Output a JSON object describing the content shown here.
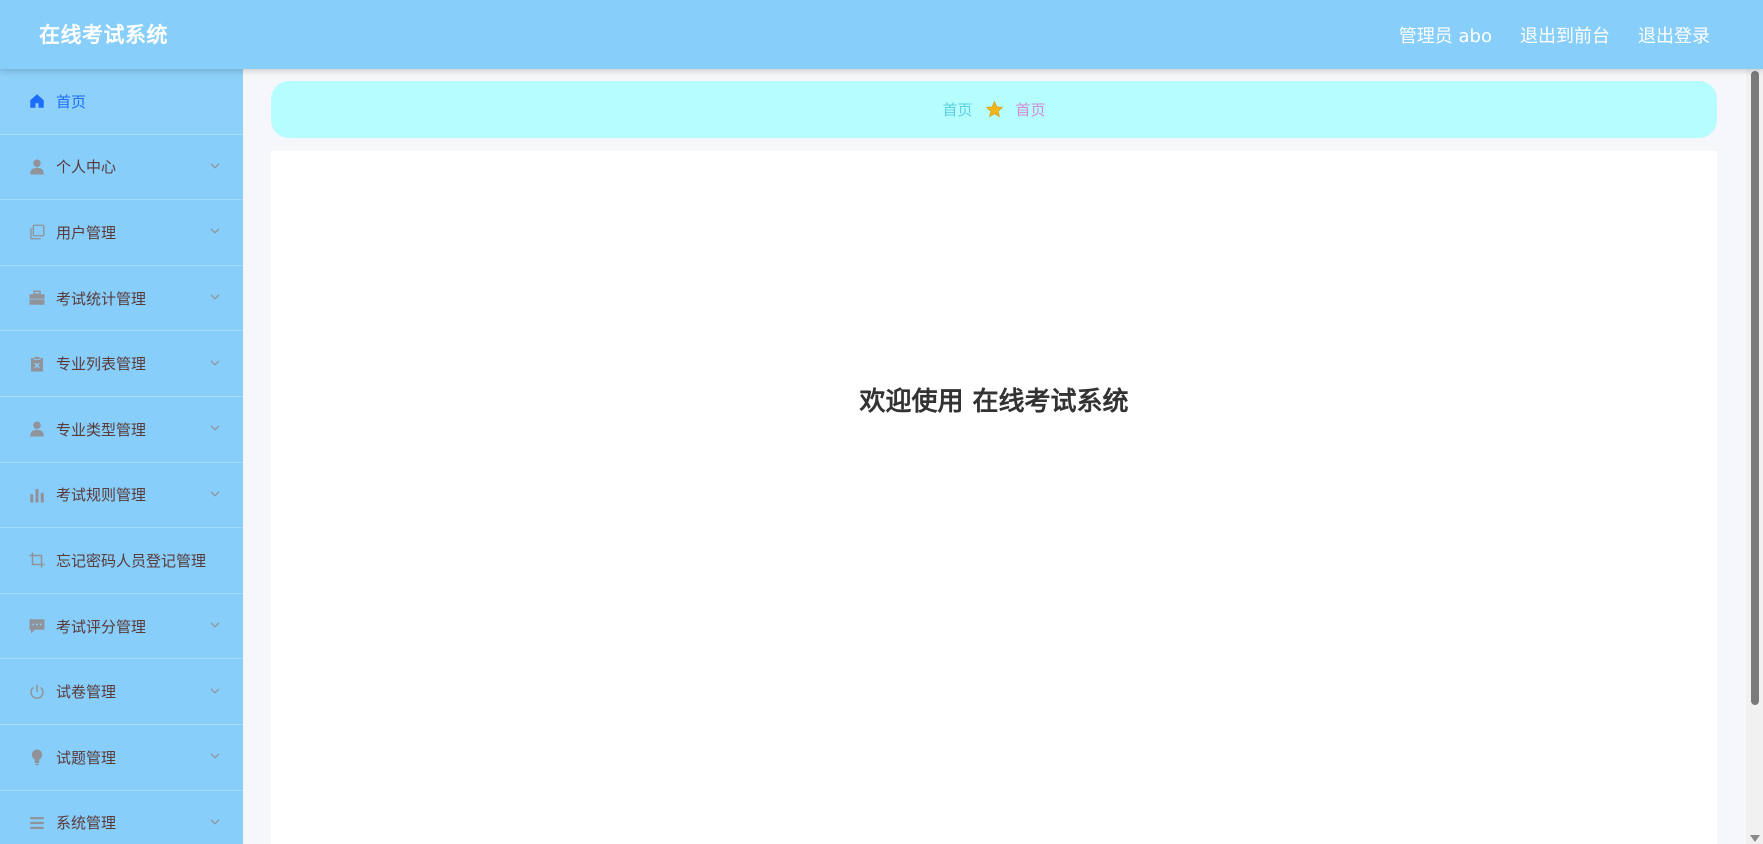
{
  "app": {
    "title": "在线考试系统"
  },
  "header": {
    "user_label": "管理员 abo",
    "to_front_label": "退出到前台",
    "logout_label": "退出登录"
  },
  "sidebar": {
    "items": [
      {
        "label": "首页",
        "icon": "home-icon",
        "active": true,
        "has_submenu": false
      },
      {
        "label": "个人中心",
        "icon": "user-icon",
        "has_submenu": true
      },
      {
        "label": "用户管理",
        "icon": "copy-icon",
        "has_submenu": true
      },
      {
        "label": "考试统计管理",
        "icon": "briefcase-icon",
        "has_submenu": true
      },
      {
        "label": "专业列表管理",
        "icon": "clipboard-x-icon",
        "has_submenu": true
      },
      {
        "label": "专业类型管理",
        "icon": "user-icon",
        "has_submenu": true
      },
      {
        "label": "考试规则管理",
        "icon": "bar-chart-icon",
        "has_submenu": true
      },
      {
        "label": "忘记密码人员登记管理",
        "icon": "crop-icon",
        "has_submenu": false
      },
      {
        "label": "考试评分管理",
        "icon": "chat-icon",
        "has_submenu": true
      },
      {
        "label": "试卷管理",
        "icon": "power-icon",
        "has_submenu": true
      },
      {
        "label": "试题管理",
        "icon": "bulb-icon",
        "has_submenu": true
      },
      {
        "label": "系统管理",
        "icon": "list-icon",
        "has_submenu": true
      }
    ]
  },
  "breadcrumb": {
    "home": "首页",
    "separator_icon": "star-icon",
    "current": "首页"
  },
  "main": {
    "welcome": "欢迎使用 在线考试系统"
  },
  "colors": {
    "header_bg": "#87cefa",
    "sidebar_bg": "#87cefa",
    "breadcrumb_bg": "#b6fdfd",
    "active_menu_text": "#1e6cff",
    "menu_text": "#5a3a3a",
    "breadcrumb_home": "#5ccfe6",
    "breadcrumb_current": "#d38bd6"
  }
}
